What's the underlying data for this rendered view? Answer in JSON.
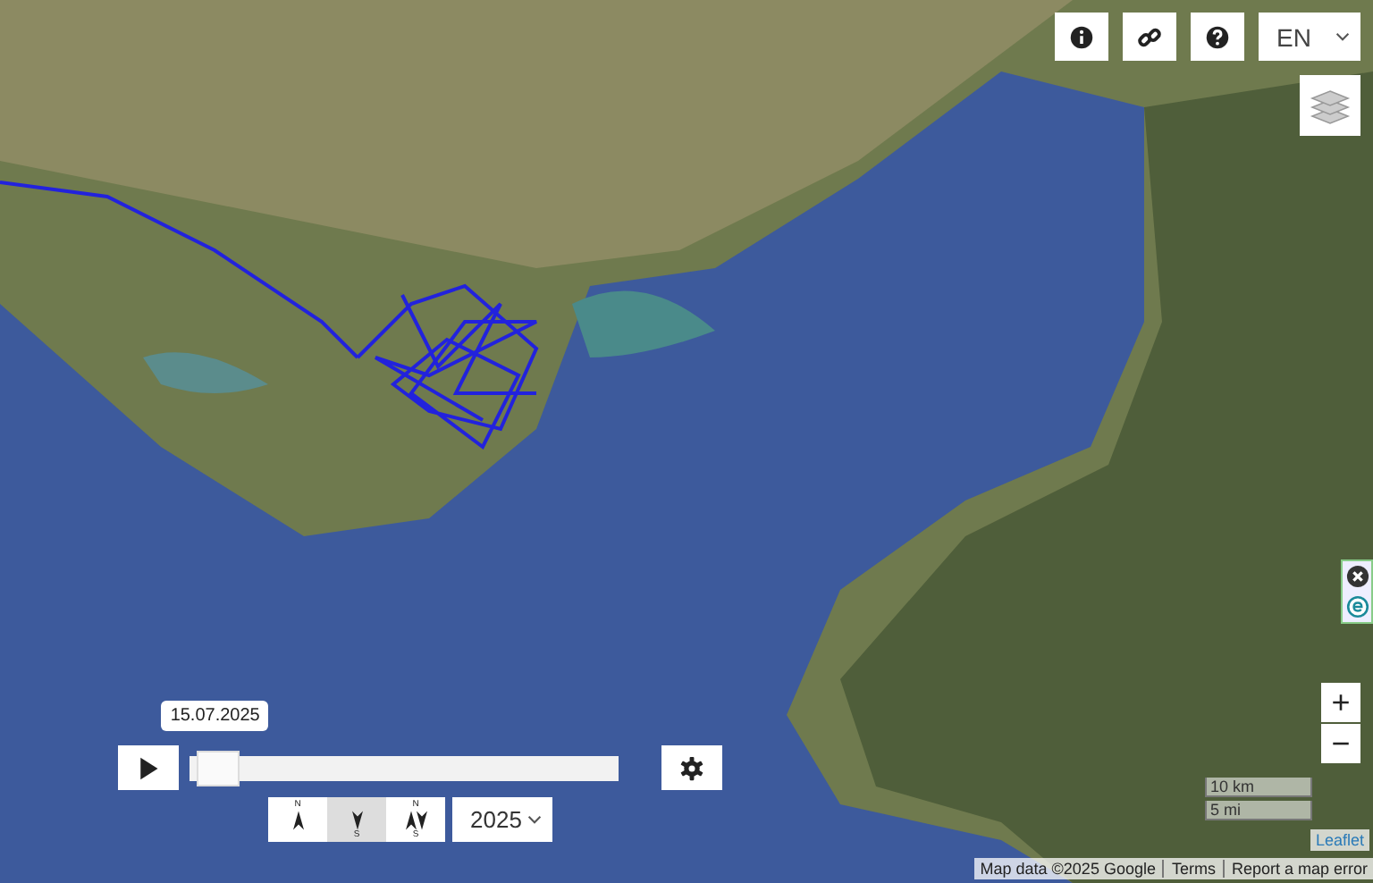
{
  "top_controls": {
    "language": "EN"
  },
  "timeline": {
    "date": "15.07.2025",
    "level": 0.02
  },
  "view_modes": [
    {
      "kind": "north",
      "top": "N",
      "selected": false
    },
    {
      "kind": "south",
      "bottom": "S",
      "selected": true
    },
    {
      "kind": "both",
      "top": "N",
      "bottom": "S",
      "selected": false
    }
  ],
  "year": "2025",
  "zoom": {
    "in": "+",
    "out": "−"
  },
  "scale": [
    "10 km",
    "5 mi"
  ],
  "leaflet": "Leaflet",
  "attribution": {
    "data": "Map data ©2025 Google",
    "terms": "Terms",
    "report": "Report a map error"
  }
}
